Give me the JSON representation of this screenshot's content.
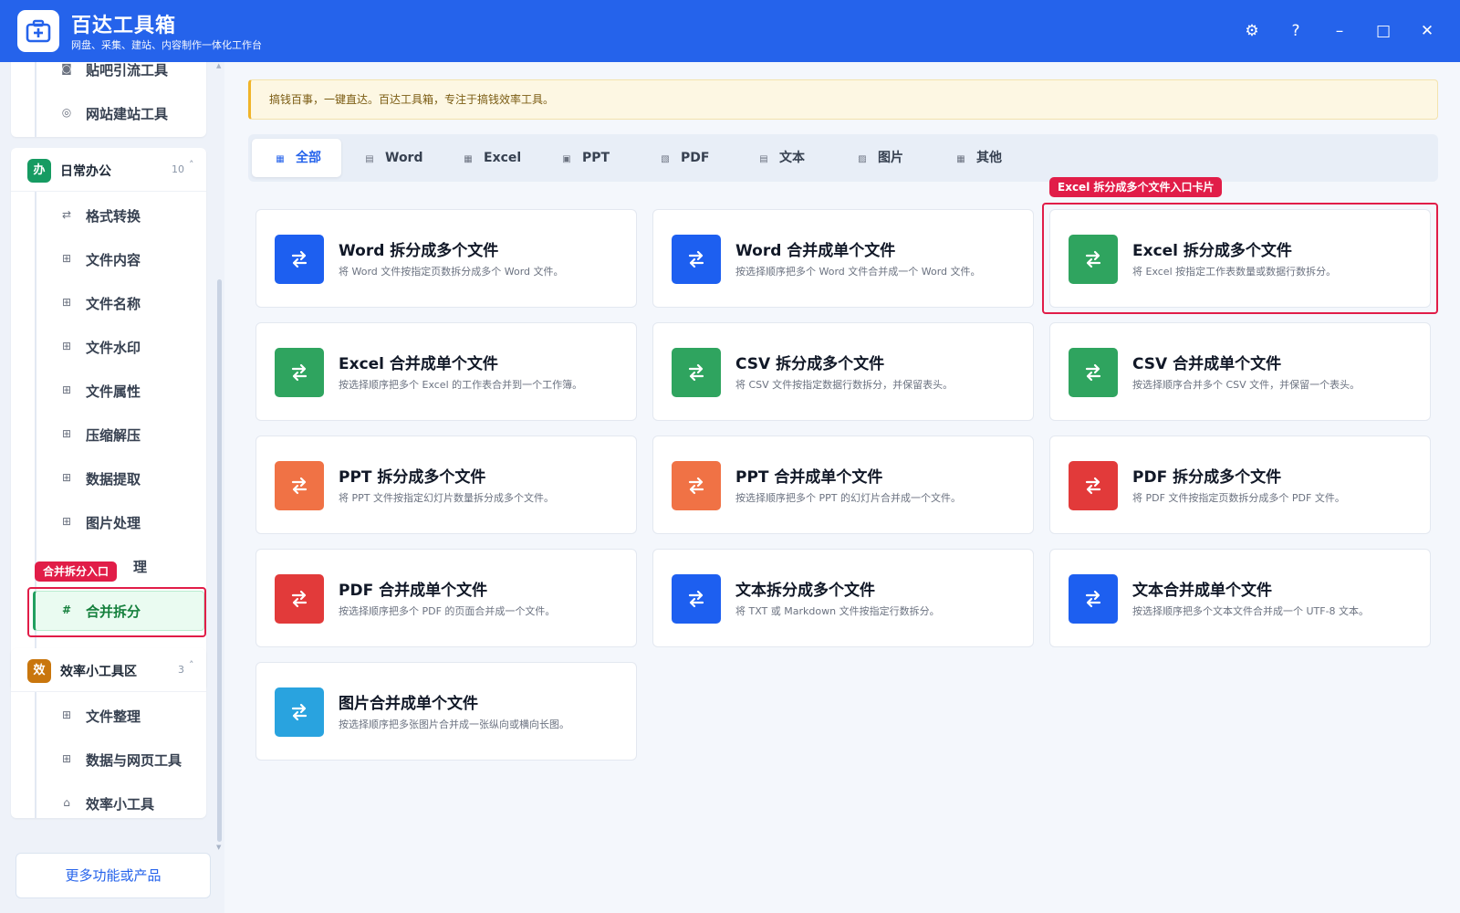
{
  "app": {
    "title": "百达工具箱",
    "subtitle": "网盘、采集、建站、内容制作一体化工作台"
  },
  "window_controls": {
    "settings": "⚙",
    "help": "?",
    "minimize": "–",
    "maximize": "□",
    "close": "✕"
  },
  "sidebar": {
    "top_items": [
      {
        "label": "贴吧引流工具",
        "icon": "◙"
      },
      {
        "label": "网站建站工具",
        "icon": "◎"
      }
    ],
    "daily_office": {
      "badge": "办",
      "title": "日常办公",
      "count": "10",
      "caret": "˄",
      "items": [
        {
          "label": "格式转换",
          "icon": "⇄"
        },
        {
          "label": "文件内容",
          "icon": "⊞"
        },
        {
          "label": "文件名称",
          "icon": "⊞"
        },
        {
          "label": "文件水印",
          "icon": "⊞"
        },
        {
          "label": "文件属性",
          "icon": "⊞"
        },
        {
          "label": "压缩解压",
          "icon": "⊞"
        },
        {
          "label": "数据提取",
          "icon": "⊞"
        },
        {
          "label": "图片处理",
          "icon": "⊞"
        },
        {
          "label": "理",
          "icon": "⊞"
        }
      ],
      "active_item": {
        "label": "合并拆分",
        "icon": "#"
      }
    },
    "efficiency": {
      "badge": "效",
      "title": "效率小工具区",
      "count": "3",
      "caret": "˄",
      "items": [
        {
          "label": "文件整理",
          "icon": "⊞"
        },
        {
          "label": "数据与网页工具",
          "icon": "⊞"
        },
        {
          "label": "效率小工具",
          "icon": "⌂"
        }
      ]
    },
    "more_button": "更多功能或产品"
  },
  "annotations": {
    "sidebar_tag": "合并拆分入口",
    "card_tag": "Excel 拆分成多个文件入口卡片"
  },
  "notice": "搞钱百事，一键直达。百达工具箱，专注于搞钱效率工具。",
  "tabs": [
    {
      "label": "全部",
      "icon": "grid-icon",
      "active": true
    },
    {
      "label": "Word",
      "icon": "doc-icon"
    },
    {
      "label": "Excel",
      "icon": "sheet-icon"
    },
    {
      "label": "PPT",
      "icon": "slide-icon"
    },
    {
      "label": "PDF",
      "icon": "pdf-icon"
    },
    {
      "label": "文本",
      "icon": "text-icon"
    },
    {
      "label": "图片",
      "icon": "image-icon"
    },
    {
      "label": "其他",
      "icon": "grid-icon"
    }
  ],
  "colors": {
    "brand": "#2563eb",
    "word": "#1d5ff0",
    "excel": "#2fa45f",
    "ppt": "#f07245",
    "pdf": "#e23a3a",
    "text": "#1d5ff0",
    "image": "#29a3df",
    "highlight": "#e11d48"
  },
  "cards": [
    {
      "title": "Word 拆分成多个文件",
      "desc": "将 Word 文件按指定页数拆分成多个 Word 文件。",
      "color": "#1d5ff0"
    },
    {
      "title": "Word 合并成单个文件",
      "desc": "按选择顺序把多个 Word 文件合并成一个 Word 文件。",
      "color": "#1d5ff0"
    },
    {
      "title": "Excel 拆分成多个文件",
      "desc": "将 Excel 按指定工作表数量或数据行数拆分。",
      "color": "#2fa45f"
    },
    {
      "title": "Excel 合并成单个文件",
      "desc": "按选择顺序把多个 Excel 的工作表合并到一个工作簿。",
      "color": "#2fa45f"
    },
    {
      "title": "CSV 拆分成多个文件",
      "desc": "将 CSV 文件按指定数据行数拆分，并保留表头。",
      "color": "#2fa45f"
    },
    {
      "title": "CSV 合并成单个文件",
      "desc": "按选择顺序合并多个 CSV 文件，并保留一个表头。",
      "color": "#2fa45f"
    },
    {
      "title": "PPT 拆分成多个文件",
      "desc": "将 PPT 文件按指定幻灯片数量拆分成多个文件。",
      "color": "#f07245"
    },
    {
      "title": "PPT 合并成单个文件",
      "desc": "按选择顺序把多个 PPT 的幻灯片合并成一个文件。",
      "color": "#f07245"
    },
    {
      "title": "PDF 拆分成多个文件",
      "desc": "将 PDF 文件按指定页数拆分成多个 PDF 文件。",
      "color": "#e23a3a"
    },
    {
      "title": "PDF 合并成单个文件",
      "desc": "按选择顺序把多个 PDF 的页面合并成一个文件。",
      "color": "#e23a3a"
    },
    {
      "title": "文本拆分成多个文件",
      "desc": "将 TXT 或 Markdown 文件按指定行数拆分。",
      "color": "#1d5ff0"
    },
    {
      "title": "文本合并成单个文件",
      "desc": "按选择顺序把多个文本文件合并成一个 UTF-8 文本。",
      "color": "#1d5ff0"
    },
    {
      "title": "图片合并成单个文件",
      "desc": "按选择顺序把多张图片合并成一张纵向或横向长图。",
      "color": "#29a3df"
    }
  ]
}
